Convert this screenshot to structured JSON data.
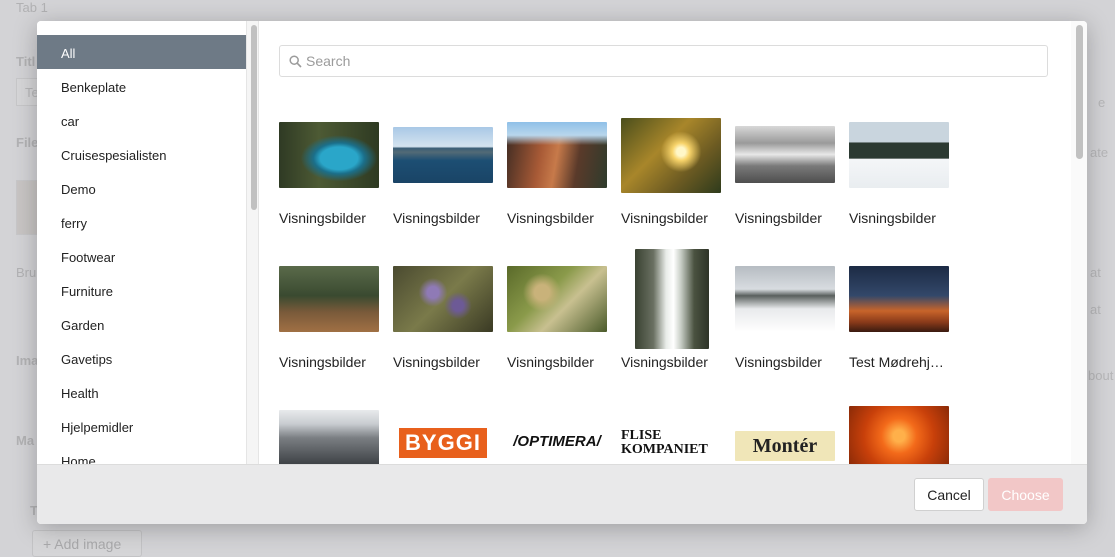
{
  "background": {
    "tab": "Tab 1",
    "labels": [
      "Titl",
      "File",
      "Bru",
      "Ima",
      "Ma",
      "T"
    ],
    "field_prefix": "Te",
    "right_texts": [
      "e",
      "ate",
      "at",
      "at",
      "bout"
    ],
    "add_image": "+ Add image"
  },
  "sidebar": {
    "categories": [
      "All",
      "Benkeplate",
      "car",
      "Cruisespesialisten",
      "Demo",
      "ferry",
      "Footwear",
      "Furniture",
      "Garden",
      "Gavetips",
      "Health",
      "Hjelpemidler",
      "Home"
    ],
    "active": "All"
  },
  "search": {
    "placeholder": "Search",
    "value": ""
  },
  "grid": {
    "rows": [
      {
        "items": [
          {
            "label": "Visningsbilder",
            "icon": "lake-forest-photo"
          },
          {
            "label": "Visningsbilder",
            "icon": "kayak-lake-photo"
          },
          {
            "label": "Visningsbilder",
            "icon": "canyon-rock-photo"
          },
          {
            "label": "Visningsbilder",
            "icon": "autumn-leaves-sun-photo"
          },
          {
            "label": "Visningsbilder",
            "icon": "cloudy-sea-photo"
          },
          {
            "label": "Visningsbilder",
            "icon": "snow-cabin-photo"
          }
        ]
      },
      {
        "items": [
          {
            "label": "Visningsbilder",
            "icon": "hiker-boardwalk-photo"
          },
          {
            "label": "Visningsbilder",
            "icon": "lavender-flowers-photo"
          },
          {
            "label": "Visningsbilder",
            "icon": "green-foliage-photo"
          },
          {
            "label": "Visningsbilder",
            "icon": "waterfall-rainbow-photo"
          },
          {
            "label": "Visningsbilder",
            "icon": "snowy-mountain-photo"
          },
          {
            "label": "Test Mødrehj…",
            "icon": "star-trails-photo"
          }
        ]
      },
      {
        "items": [
          {
            "label": "",
            "icon": "skyscraper-photo"
          },
          {
            "label": "",
            "icon": "byggi-logo",
            "logo_text": "BYGGI"
          },
          {
            "label": "",
            "icon": "optimera-logo",
            "logo_text": "/OPTIMERA/"
          },
          {
            "label": "",
            "icon": "flise-kompaniet-logo",
            "logo_text": "FLISE KOMPANIET"
          },
          {
            "label": "",
            "icon": "monter-logo",
            "logo_text": "Montér"
          },
          {
            "label": "",
            "icon": "orange-flower-photo"
          }
        ]
      }
    ]
  },
  "footer": {
    "cancel_label": "Cancel",
    "choose_label": "Choose"
  },
  "colors": {
    "active_category": "#6e7a86",
    "choose_disabled": "#f2c7c7",
    "byggi": "#e8601c"
  }
}
